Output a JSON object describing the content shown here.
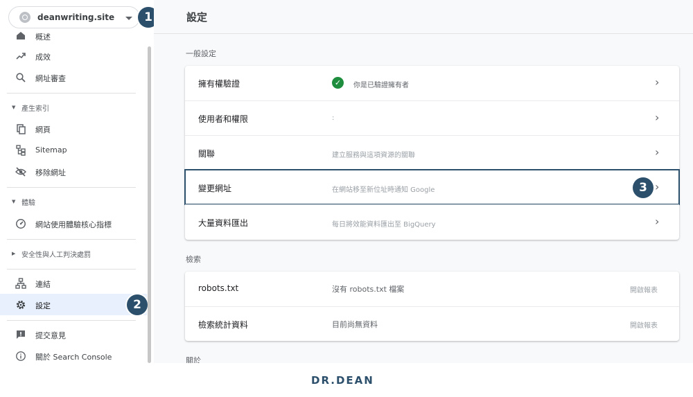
{
  "property": {
    "name": "deanwriting.site"
  },
  "badges": {
    "one": "1",
    "two": "2",
    "three": "3"
  },
  "sidebar": {
    "items_top": [
      {
        "label": "概述",
        "icon": "home-icon"
      },
      {
        "label": "成效",
        "icon": "trending-up-icon"
      },
      {
        "label": "網址審查",
        "icon": "search-icon"
      }
    ],
    "section_indexing": "產生索引",
    "items_indexing": [
      {
        "label": "網頁",
        "icon": "pages-icon"
      },
      {
        "label": "Sitemap",
        "icon": "sitemap-icon"
      },
      {
        "label": "移除網址",
        "icon": "eye-off-icon"
      }
    ],
    "section_experience": "體驗",
    "items_experience": [
      {
        "label": "網站使用體驗核心指標",
        "icon": "speed-icon"
      }
    ],
    "section_security": "安全性與人工判決處罰",
    "items_bottom": [
      {
        "label": "連結",
        "icon": "links-icon"
      },
      {
        "label": "設定",
        "icon": "gear-icon",
        "selected": true
      }
    ],
    "items_footer": [
      {
        "label": "提交意見",
        "icon": "feedback-icon"
      },
      {
        "label": "關於 Search Console",
        "icon": "info-icon"
      }
    ]
  },
  "main": {
    "title": "設定",
    "general_label": "一般設定",
    "general_rows": [
      {
        "name": "擁有權驗證",
        "desc": "你是已驗證擁有者",
        "verified": true
      },
      {
        "name": "使用者和權限",
        "desc": ":"
      },
      {
        "name": "關聯",
        "desc": "建立服務與這項資源的關聯"
      },
      {
        "name": "變更網址",
        "desc": "在網站移至新位址時通知 Google"
      },
      {
        "name": "大量資料匯出",
        "desc": "每日將效能資料匯出至 BigQuery"
      }
    ],
    "crawl_label": "檢索",
    "crawl_rows": [
      {
        "name": "robots.txt",
        "desc": "沒有 robots.txt 檔案",
        "action": "開啟報表"
      },
      {
        "name": "檢索統計資料",
        "desc": "目前尚無資料",
        "action": "開啟報表"
      }
    ],
    "about_label": "關於"
  },
  "brand": {
    "logo": "DR.DEAN"
  },
  "colors": {
    "accent": "#2c4f6b",
    "selected_bg": "#e8f0fe",
    "verified": "#1e8e3e"
  }
}
